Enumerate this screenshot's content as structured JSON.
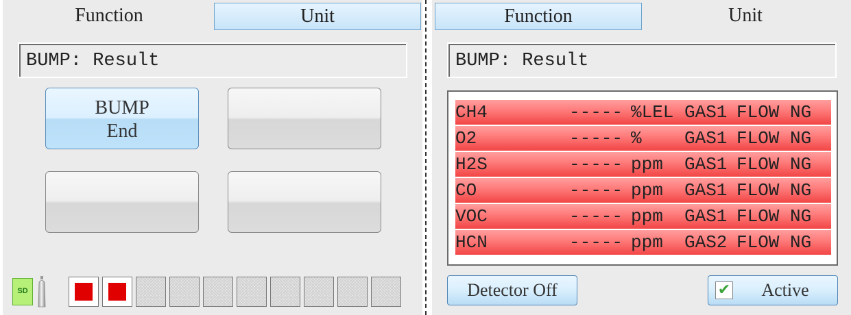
{
  "left": {
    "tabs": {
      "function": "Function",
      "unit": "Unit"
    },
    "title": "BUMP: Result",
    "buttons": [
      {
        "line1": "BUMP",
        "line2": "End"
      },
      {
        "line1": "",
        "line2": ""
      },
      {
        "line1": "",
        "line2": ""
      },
      {
        "line1": "",
        "line2": ""
      }
    ],
    "status": {
      "sd_label": "SD",
      "slots": [
        "filled",
        "filled",
        "empty",
        "empty",
        "empty",
        "empty",
        "empty",
        "empty",
        "empty",
        "empty"
      ]
    }
  },
  "right": {
    "tabs": {
      "function": "Function",
      "unit": "Unit"
    },
    "title": "BUMP: Result",
    "rows": [
      {
        "gas": "CH4",
        "value": "-----",
        "unit": "%LEL",
        "channel": "GAS1",
        "status": "FLOW",
        "result": "NG"
      },
      {
        "gas": "O2",
        "value": "-----",
        "unit": "%",
        "channel": "GAS1",
        "status": "FLOW",
        "result": "NG"
      },
      {
        "gas": "H2S",
        "value": "-----",
        "unit": "ppm",
        "channel": "GAS1",
        "status": "FLOW",
        "result": "NG"
      },
      {
        "gas": "CO",
        "value": "-----",
        "unit": "ppm",
        "channel": "GAS1",
        "status": "FLOW",
        "result": "NG"
      },
      {
        "gas": "VOC",
        "value": "-----",
        "unit": "ppm",
        "channel": "GAS1",
        "status": "FLOW",
        "result": "NG"
      },
      {
        "gas": "HCN",
        "value": "-----",
        "unit": "ppm",
        "channel": "GAS2",
        "status": "FLOW",
        "result": "NG"
      }
    ],
    "detector_off": "Detector Off",
    "active": "Active",
    "active_check": "✔"
  },
  "colors": {
    "fail_row": "#f24545",
    "tab_blue": "#c8e4f8",
    "alarm_red": "#e00000"
  },
  "icons": {
    "sd": "sd-card-icon",
    "bottle": "gas-bottle-icon",
    "check": "checkmark-icon"
  }
}
